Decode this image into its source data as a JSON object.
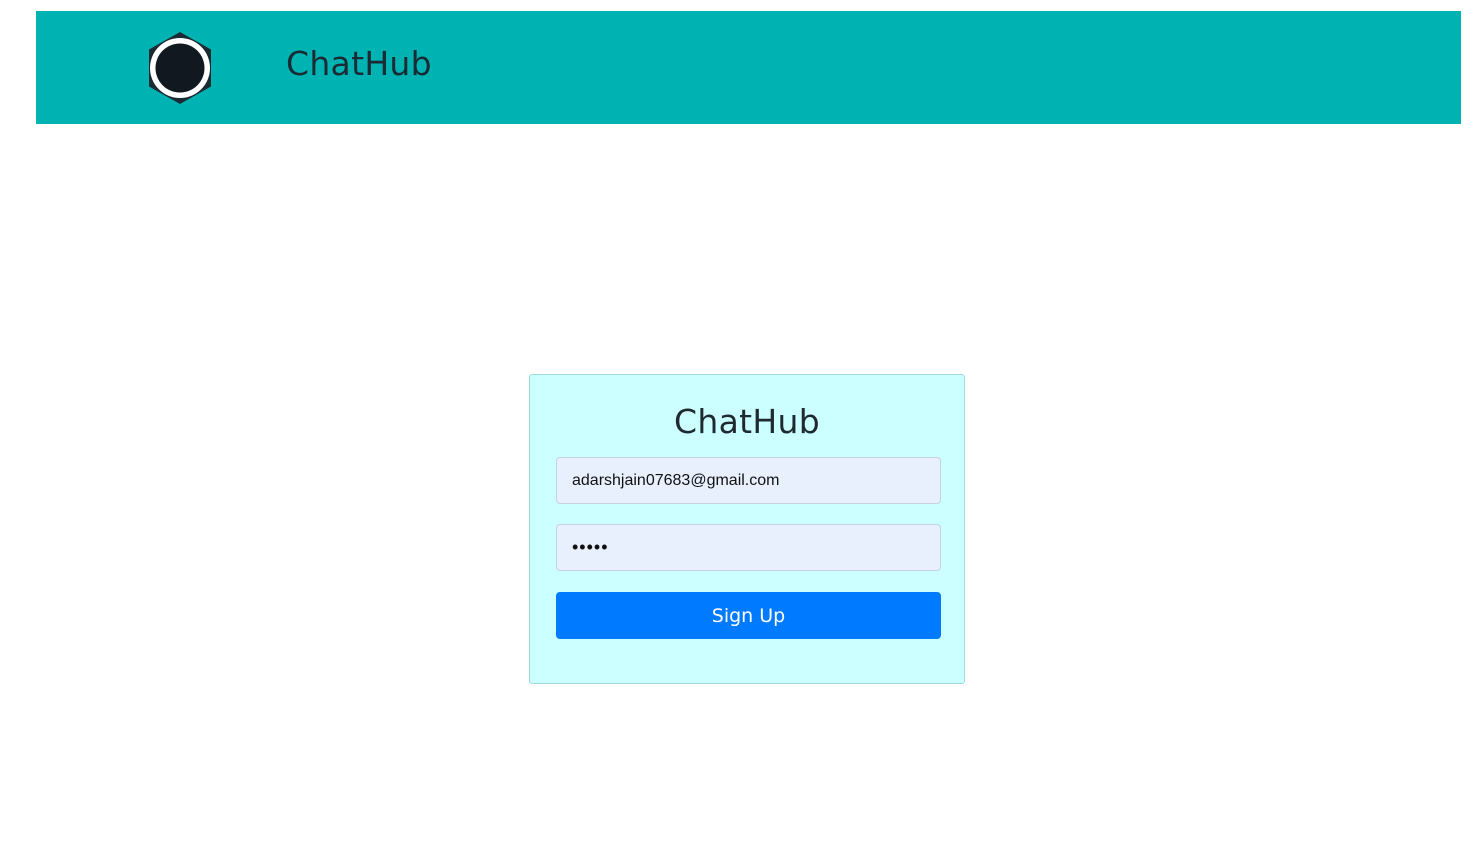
{
  "navbar": {
    "brand": "ChatHub",
    "logo_icon": "hexagon-ring-logo-icon",
    "background_color": "#00b3b3"
  },
  "signup_card": {
    "title": "ChatHub",
    "email_value": "adarshjain07683@gmail.com",
    "password_value": "12345",
    "submit_label": "Sign Up",
    "background_color": "#ccffff",
    "button_color": "#007bff"
  }
}
